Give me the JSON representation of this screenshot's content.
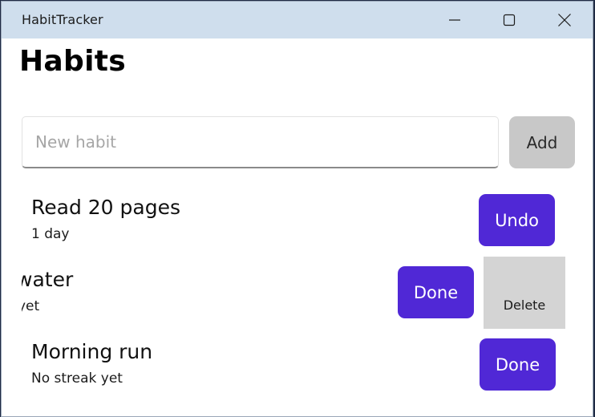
{
  "window": {
    "title": "HabitTracker"
  },
  "page": {
    "title": "Habits"
  },
  "new_habit": {
    "placeholder": "New habit",
    "value": "",
    "add_label": "Add"
  },
  "habits": [
    {
      "name": "Read 20 pages",
      "streak": "1 day",
      "action": "Undo"
    },
    {
      "name": "water",
      "streak": "yet",
      "action": "Done",
      "swipe_action": "Delete"
    },
    {
      "name": "Morning run",
      "streak": "No streak yet",
      "action": "Done"
    }
  ],
  "colors": {
    "titlebar": "#cfdeed",
    "accent": "#5028d6",
    "add_button": "#c8c8c8",
    "delete_swipe": "#d4d4d4"
  },
  "icons": {
    "minimize": "minimize-icon",
    "maximize": "maximize-icon",
    "close": "close-icon"
  }
}
